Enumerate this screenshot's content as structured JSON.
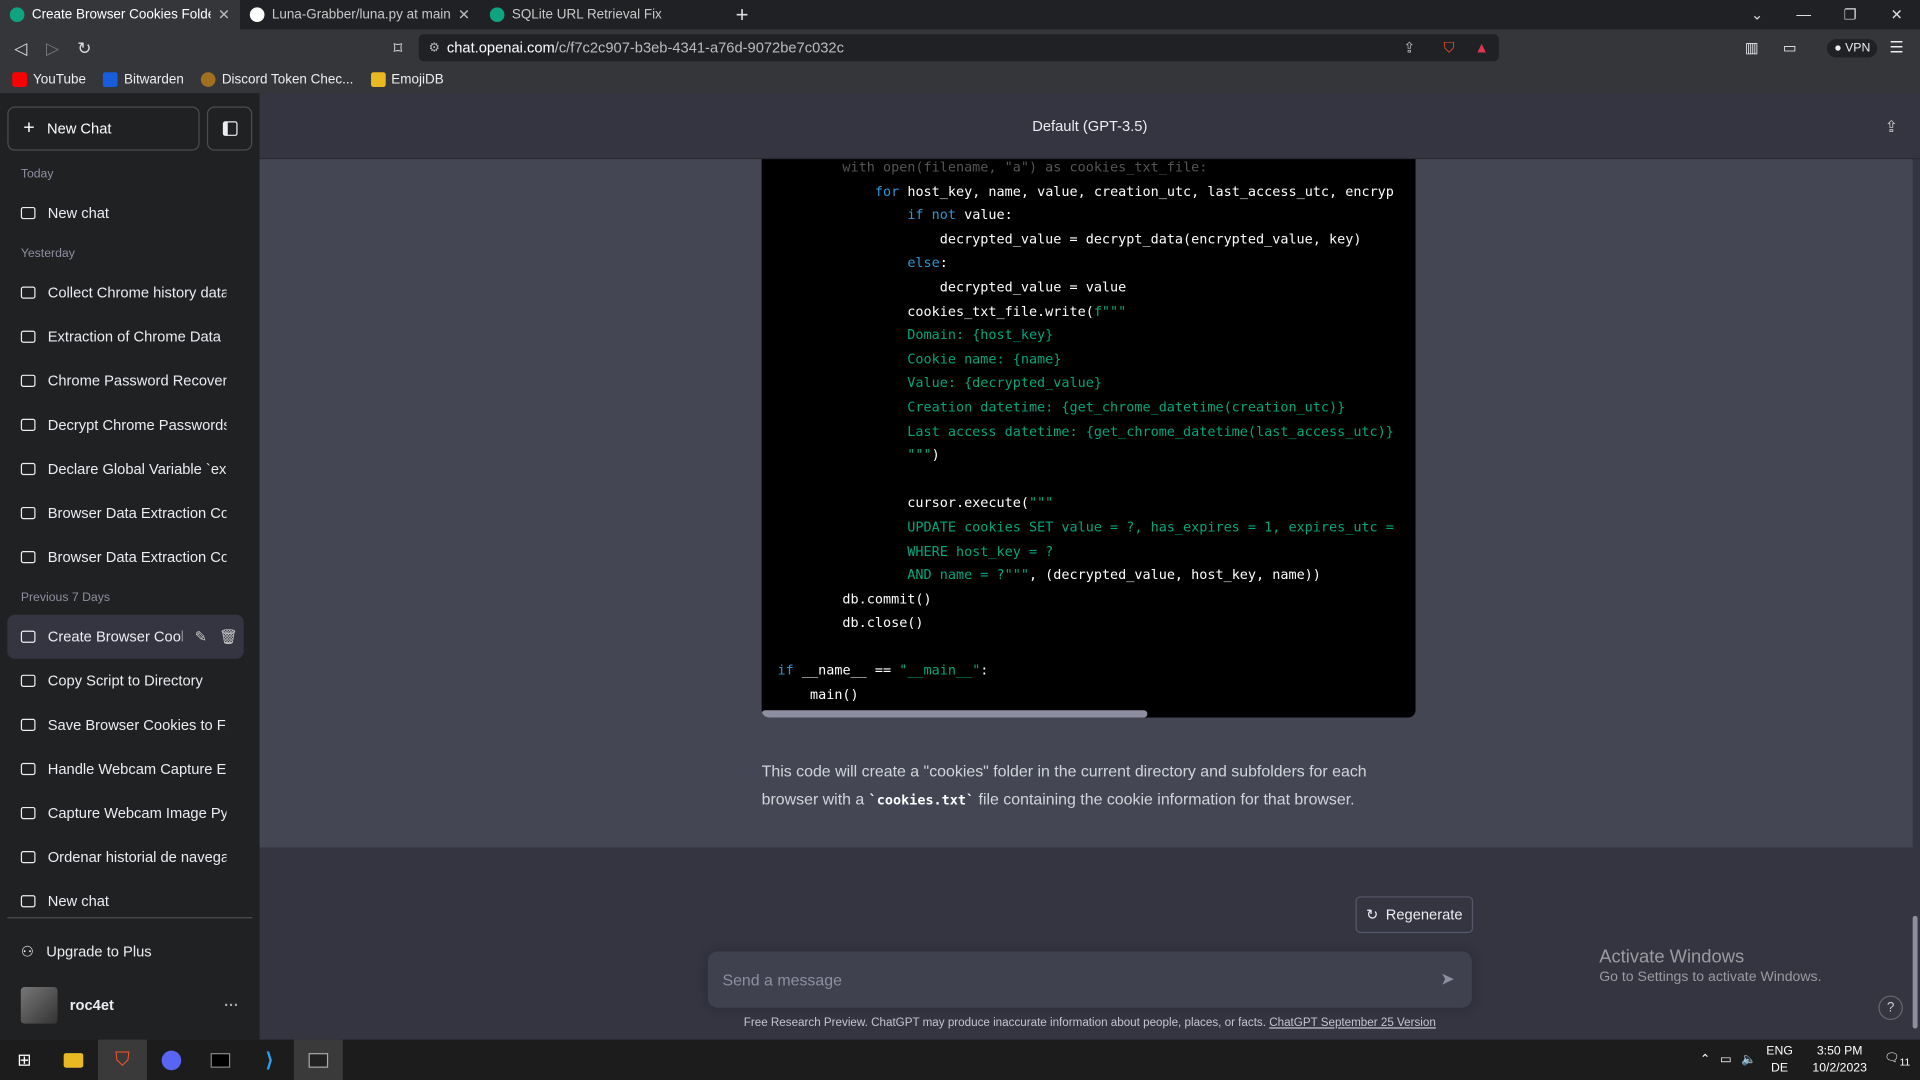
{
  "browser": {
    "tabs": [
      {
        "title": "Create Browser Cookies Folders",
        "active": true
      },
      {
        "title": "Luna-Grabber/luna.py at main · Smug",
        "active": false
      },
      {
        "title": "SQLite URL Retrieval Fix",
        "active": false
      }
    ],
    "url_host": "chat.openai.com",
    "url_path": "/c/f7c2c907-b3eb-4341-a76d-9072be7c032c",
    "vpn_label": "VPN",
    "bookmarks": [
      "YouTube",
      "Bitwarden",
      "Discord Token Chec...",
      "EmojiDB"
    ]
  },
  "sidebar": {
    "new_chat": "New Chat",
    "sections": {
      "today": "Today",
      "yesterday": "Yesterday",
      "previous7": "Previous 7 Days"
    },
    "today_items": [
      "New chat"
    ],
    "yesterday_items": [
      "Collect Chrome history data.",
      "Extraction of Chrome Data",
      "Chrome Password Recovery",
      "Decrypt Chrome Passwords",
      "Declare Global Variable `exo",
      "Browser Data Extraction Cod",
      "Browser Data Extraction Cod"
    ],
    "previous_items": [
      "Create Browser Cooki",
      "Copy Script to Directory",
      "Save Browser Cookies to File",
      "Handle Webcam Capture Err",
      "Capture Webcam Image Pyth",
      "Ordenar historial de navegaci",
      "New chat"
    ],
    "upgrade": "Upgrade to Plus",
    "username": "roc4et",
    "more": "···"
  },
  "header": {
    "title": "Default (GPT-3.5)"
  },
  "message": {
    "para_before": "This code will create a \"cookies\" folder in the current directory and subfolders for each browser with a ",
    "para_code": "`cookies.txt`",
    "para_after": " file containing the cookie information for that browser."
  },
  "controls": {
    "regenerate": "Regenerate",
    "placeholder": "Send a message",
    "footer_text": "Free Research Preview. ChatGPT may produce inaccurate information about people, places, or facts. ",
    "footer_link": "ChatGPT September 25 Version",
    "help": "?"
  },
  "watermark": {
    "line1": "Activate Windows",
    "line2": "Go to Settings to activate Windows."
  },
  "taskbar": {
    "lang1": "ENG",
    "lang2": "DE",
    "time": "3:50 PM",
    "date": "10/2/2023",
    "notif": "11"
  },
  "colors": {
    "accent_code_keyword": "#2e95d3",
    "accent_code_string": "#00a67d"
  }
}
